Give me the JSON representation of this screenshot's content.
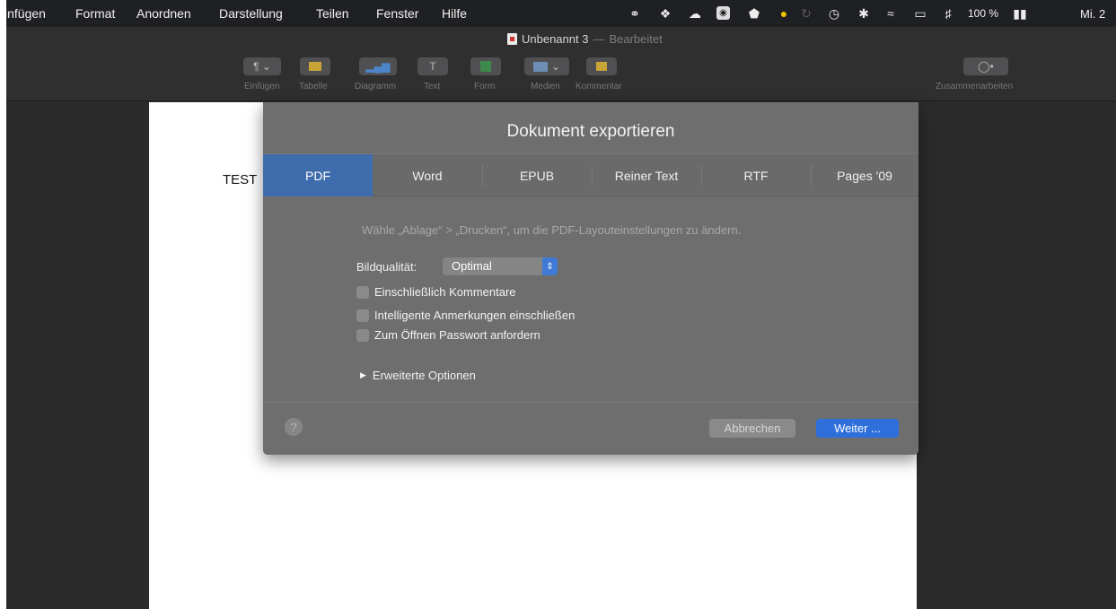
{
  "menubar": {
    "items": [
      "infügen",
      "Format",
      "Anordnen",
      "Darstellung",
      "Teilen",
      "Fenster",
      "Hilfe"
    ],
    "battery": "100 %",
    "clock": "Mi. 2"
  },
  "window": {
    "title": "Unbenannt 3",
    "title_separator": "—",
    "title_status": "Bearbeitet"
  },
  "toolbar": {
    "buttons": [
      {
        "label": "Einfügen",
        "icon": "paragraph-icon"
      },
      {
        "label": "Tabelle",
        "icon": "table-icon"
      },
      {
        "label": "Diagramm",
        "icon": "chart-icon"
      },
      {
        "label": "Text",
        "icon": "text-icon"
      },
      {
        "label": "Form",
        "icon": "shape-icon"
      },
      {
        "label": "Medien",
        "icon": "media-icon"
      },
      {
        "label": "Kommentar",
        "icon": "comment-icon"
      }
    ],
    "collab_label": "Zusammenarbeiten"
  },
  "document": {
    "text": "TEST"
  },
  "dialog": {
    "title": "Dokument exportieren",
    "tabs": [
      "PDF",
      "Word",
      "EPUB",
      "Reiner Text",
      "RTF",
      "Pages '09"
    ],
    "active_tab": "PDF",
    "hint": "Wähle „Ablage“ > „Drucken“, um die PDF-Layouteinstellungen zu ändern.",
    "quality_label": "Bildqualität:",
    "quality_value": "Optimal",
    "checkboxes": [
      {
        "label": "Einschließlich Kommentare",
        "checked": false
      },
      {
        "label": "Intelligente Anmerkungen einschließen",
        "checked": false
      },
      {
        "label": "Zum Öffnen Passwort anfordern",
        "checked": false
      }
    ],
    "advanced_label": "Erweiterte Optionen",
    "help_label": "?",
    "cancel_label": "Abbrechen",
    "continue_label": "Weiter ..."
  },
  "colors": {
    "accent": "#2e6fdb",
    "active_tab": "#3f6cad",
    "dialog_bg": "#6e6e6e"
  }
}
